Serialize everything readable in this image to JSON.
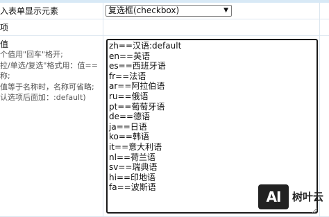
{
  "rows": {
    "display_element": {
      "label": "入表单显示元素",
      "select_value": "复选框(checkbox)"
    },
    "second": {
      "label": "项"
    },
    "options": {
      "label": "值",
      "hint_lines": [
        "个值用\"回车\"格开;",
        "拉/单选/复选\"格式用：值==",
        "称;",
        "值等于名称时，名称可省略;",
        "认选项后面加：:default)"
      ],
      "textarea_lines": [
        "zh==汉语:default",
        "en==英语",
        "es==西班牙语",
        "fr==法语",
        "ar==阿拉伯语",
        "ru==俄语",
        "pt==葡萄牙语",
        "de==德语",
        "ja==日语",
        "ko==韩语",
        "it==意大利语",
        "nl==荷兰语",
        "sv==瑞典语",
        "hi==印地语",
        "fa==波斯语"
      ]
    }
  },
  "watermark": {
    "logo": "AI",
    "text": "树叶云"
  },
  "icons": {
    "select_arrow": "chevron-down-icon",
    "resize_grip": "resize-grip-icon"
  },
  "colors": {
    "header_strip": "#d8e9f6",
    "grid_line": "#dbe6ef",
    "textarea_border": "#1a1a1a"
  }
}
